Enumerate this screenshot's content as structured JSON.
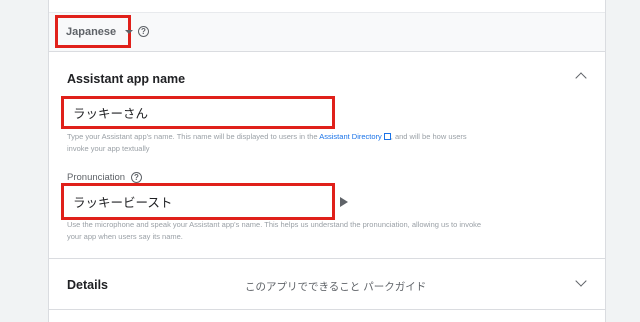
{
  "language": {
    "selected": "Japanese",
    "help_icon": "help-circle-icon"
  },
  "assistant_name": {
    "title": "Assistant app name",
    "value": "ラッキーさん",
    "hint_before_link": "Type your Assistant app's name. This name will be displayed to users in the ",
    "hint_link": "Assistant Directory",
    "hint_after_link": ", and will be how users invoke your app textually",
    "collapse_icon": "chevron-up-icon"
  },
  "pronunciation": {
    "label": "Pronunciation",
    "value": "ラッキービースト",
    "hint": "Use the microphone and speak your Assistant app's name. This helps us understand the pronunciation, allowing us to invoke your app when users say its name.",
    "play_icon": "play-icon"
  },
  "details": {
    "title": "Details",
    "subtitle": "このアプリでできること パークガイド",
    "expand_icon": "chevron-down-icon"
  },
  "colors": {
    "highlight": "#e0201a",
    "link": "#1a73e8"
  }
}
